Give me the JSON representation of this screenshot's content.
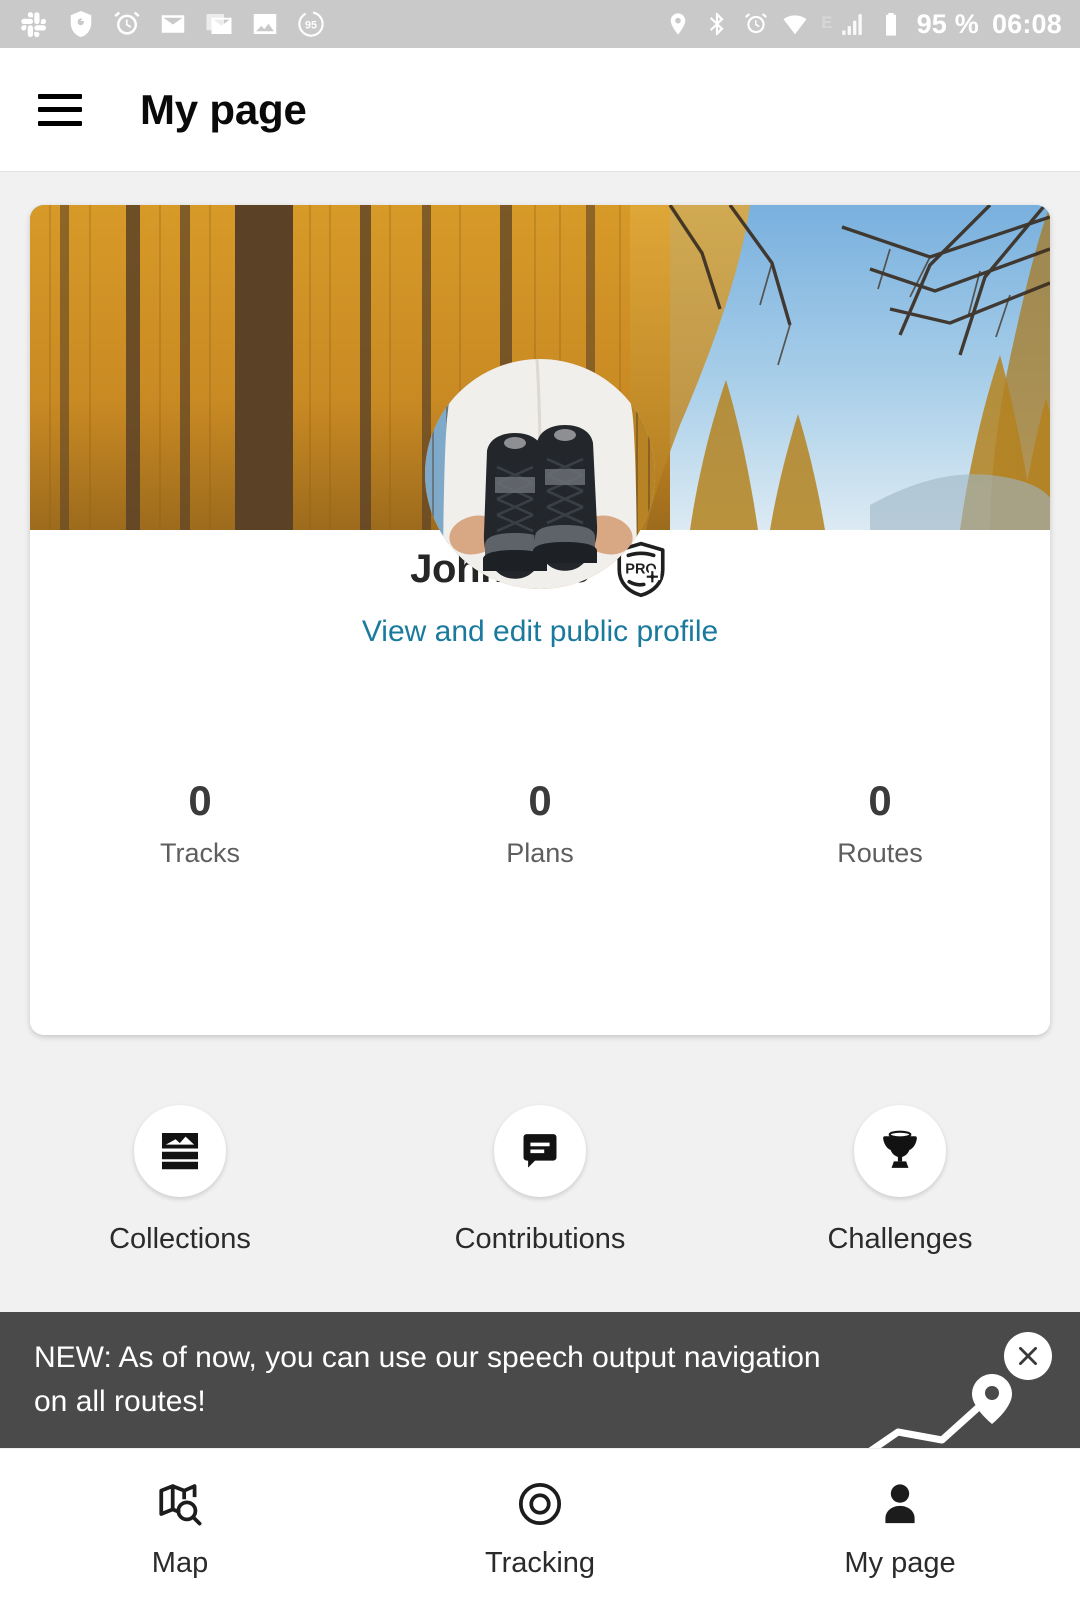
{
  "status_bar": {
    "left_icons": [
      "slack-icon",
      "shield-check-icon",
      "alarm-clock-icon",
      "mail-icon",
      "mail-stack-icon",
      "gallery-image-icon",
      "battery-percent-circle-icon"
    ],
    "battery_circle_label": "95",
    "right_icons": [
      "location-pin-icon",
      "bluetooth-icon",
      "alarm-clock-icon",
      "wifi-icon",
      "edge-network-icon",
      "signal-bars-icon",
      "battery-icon"
    ],
    "network_label": "E",
    "battery_percent": "95 %",
    "clock": "06:08"
  },
  "app_bar": {
    "menu_icon": "hamburger-menu-icon",
    "title": "My page"
  },
  "profile": {
    "cover_image_alt": "autumn larch forest with blue sky",
    "avatar_image_alt": "hands holding black hiking boots",
    "name": "John Doe",
    "badge": "pro-plus-badge-icon",
    "badge_text": "PRO",
    "public_profile_link": "View and edit public profile",
    "link_color": "#1a7a9e",
    "stats": [
      {
        "value": "0",
        "label": "Tracks"
      },
      {
        "value": "0",
        "label": "Plans"
      },
      {
        "value": "0",
        "label": "Routes"
      }
    ]
  },
  "quick_actions": [
    {
      "icon": "collections-icon",
      "label": "Collections"
    },
    {
      "icon": "comment-bubble-icon",
      "label": "Contributions"
    },
    {
      "icon": "trophy-icon",
      "label": "Challenges"
    }
  ],
  "banner": {
    "message": "NEW: As of now, you can use our speech output navigation on all routes!",
    "close_icon": "close-icon",
    "art_icon": "route-path-pin-icon",
    "background_color": "#4a4a4a"
  },
  "bottom_nav": {
    "items": [
      {
        "icon": "map-search-icon",
        "label": "Map",
        "active": false
      },
      {
        "icon": "tracking-target-icon",
        "label": "Tracking",
        "active": false
      },
      {
        "icon": "person-icon",
        "label": "My page",
        "active": true
      }
    ]
  }
}
